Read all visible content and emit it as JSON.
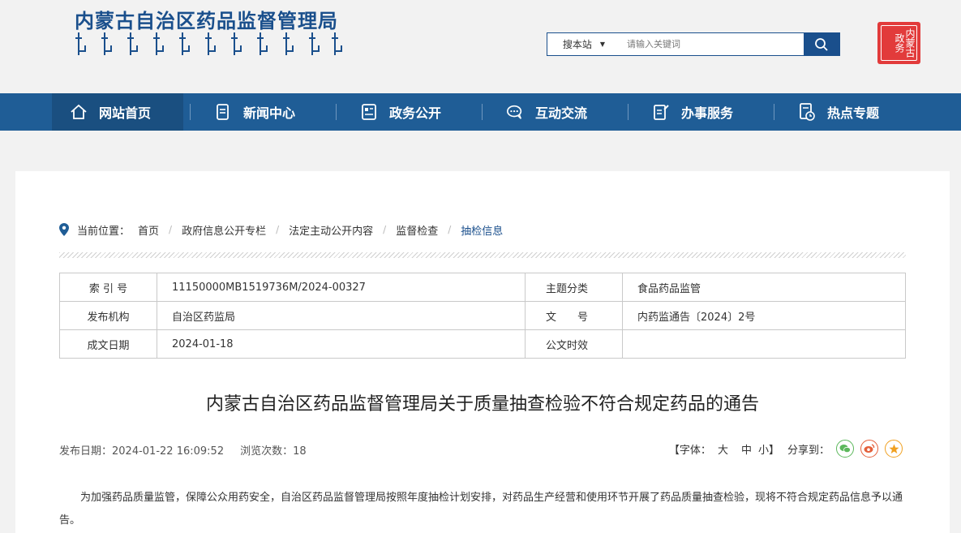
{
  "header": {
    "site_title": "内蒙古自治区药品监督管理局",
    "search": {
      "scope": "搜本站",
      "placeholder": "请输入关键词"
    },
    "seal_text": "内蒙古"
  },
  "nav": {
    "items": [
      {
        "label": "网站首页",
        "icon": "home-icon"
      },
      {
        "label": "新闻中心",
        "icon": "document-icon"
      },
      {
        "label": "政务公开",
        "icon": "grid-document-icon"
      },
      {
        "label": "互动交流",
        "icon": "chat-icon"
      },
      {
        "label": "办事服务",
        "icon": "edit-list-icon"
      },
      {
        "label": "热点专题",
        "icon": "clock-document-icon"
      }
    ],
    "active_index": 0
  },
  "breadcrumb": {
    "prefix": "当前位置：",
    "items": [
      "首页",
      "政府信息公开专栏",
      "法定主动公开内容",
      "监督检查",
      "抽检信息"
    ]
  },
  "meta": {
    "rows": [
      {
        "k1": "索 引 号",
        "v1": "11150000MB1519736M/2024-00327",
        "k2": "主题分类",
        "v2": "食品药品监管"
      },
      {
        "k1": "发布机构",
        "v1": "自治区药监局",
        "k2": "文　　号",
        "v2": "内药监通告〔2024〕2号"
      },
      {
        "k1": "成文日期",
        "v1": "2024-01-18",
        "k2": "公文时效",
        "v2": ""
      }
    ]
  },
  "article": {
    "title": "内蒙古自治区药品监督管理局关于质量抽查检验不符合规定药品的通告",
    "publish_label": "发布日期：",
    "publish_date": "2024-01-22 16:09:52",
    "views_label": "浏览次数：",
    "views": "18",
    "font_label": "【字体：",
    "font_large": "大",
    "font_medium": "中",
    "font_small": "小】",
    "share_label": "分享到：",
    "body": "为加强药品质量监管，保障公众用药安全，自治区药品监督管理局按照年度抽检计划安排，对药品生产经营和使用环节开展了药品质量抽查检验，现将不符合规定药品信息予以通告。"
  },
  "colors": {
    "brand": "#1f5d96",
    "seal": "#e23b3b",
    "wechat": "#5cb85c",
    "weibo": "#e4603b",
    "favorite": "#f0a020"
  }
}
